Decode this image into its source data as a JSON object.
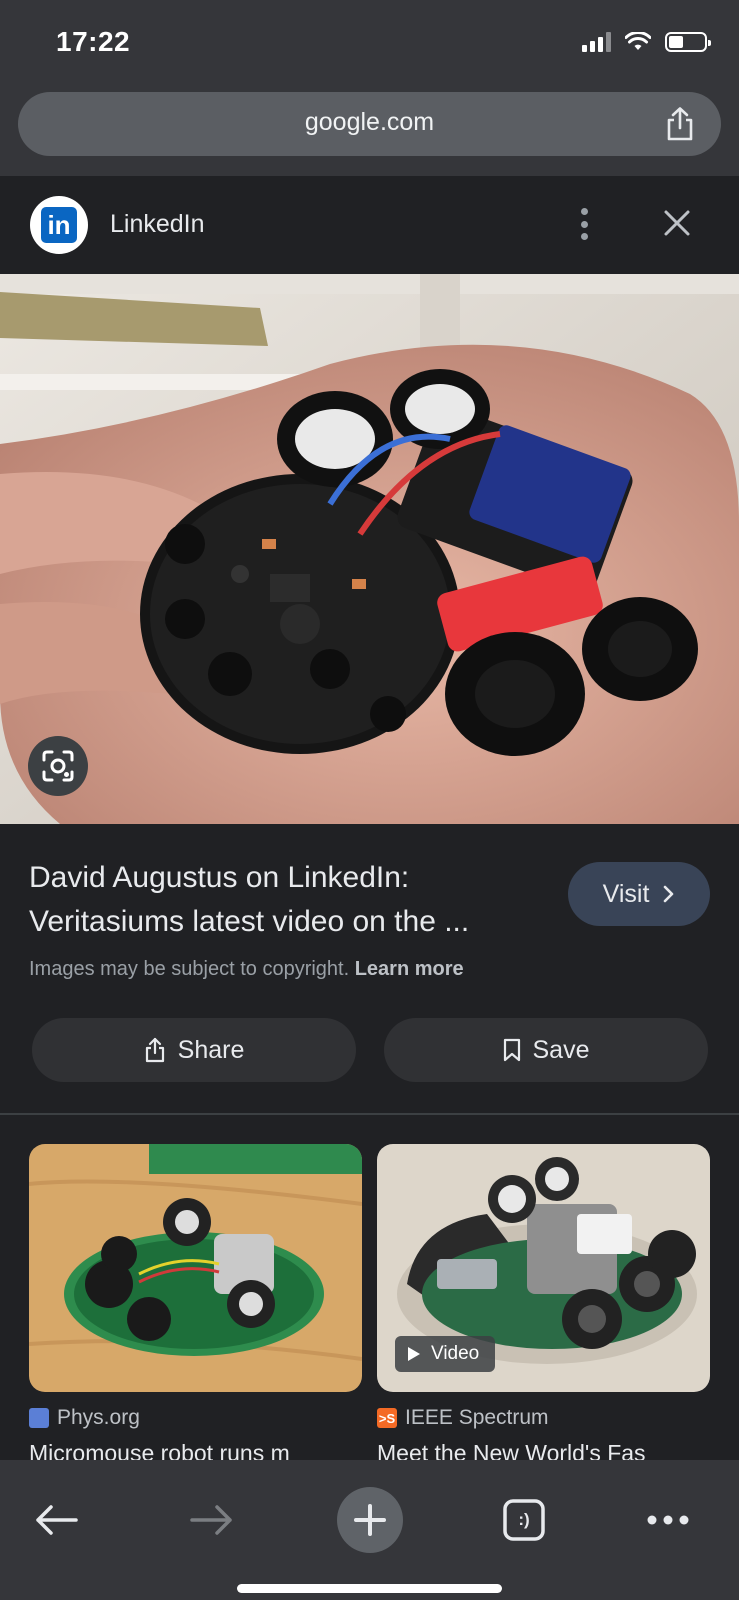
{
  "status_bar": {
    "time": "17:22",
    "icons": [
      "cellular-signal-icon",
      "wifi-icon",
      "battery-icon"
    ]
  },
  "url_bar": {
    "url": "google.com",
    "share_icon": "share-icon"
  },
  "panel": {
    "site_name": "LinkedIn",
    "site_logo_text": "in",
    "title": "David Augustus on LinkedIn: Veritasiums latest video on the ...",
    "visit_label": "Visit",
    "copyright_text": "Images may be subject to copyright.",
    "learn_more": "Learn more",
    "share_label": "Share",
    "save_label": "Save"
  },
  "related": [
    {
      "source": "Phys.org",
      "title": "Micromouse robot runs m",
      "favicon_color": "#5b7fd6"
    },
    {
      "source": "IEEE Spectrum",
      "title": "Meet the New World's Fas",
      "favicon_text": ">S",
      "favicon_color": "#f46a25",
      "badge": "Video"
    }
  ],
  "toolbar": {
    "items": [
      "back-icon",
      "forward-icon",
      "new-tab-icon",
      "tab-switcher-icon",
      "more-menu-icon"
    ],
    "tabs_glyph": ":)"
  },
  "colors": {
    "background": "#202124",
    "chrome": "#35363a",
    "visit_button": "#394457",
    "linkedin_blue": "#0a66c2"
  }
}
